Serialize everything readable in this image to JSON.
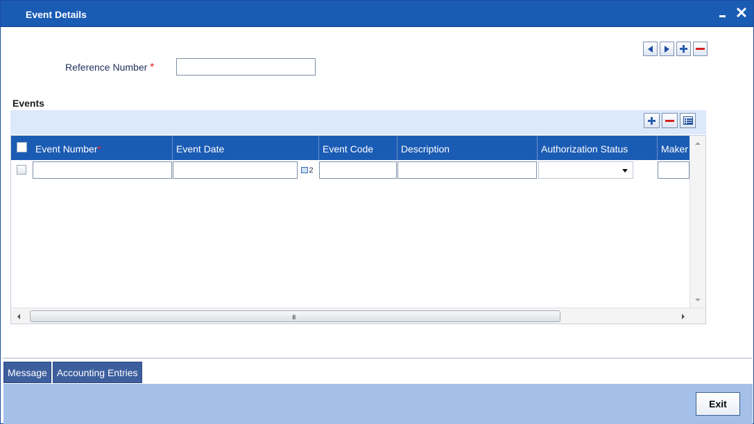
{
  "window": {
    "title": "Event Details",
    "controls": {
      "minimize": "minimize-icon",
      "close": "✕"
    }
  },
  "nav": [
    "prev-record-icon",
    "next-record-icon",
    "add-record-icon",
    "delete-record-icon"
  ],
  "reference": {
    "label": "Reference Number",
    "required_mark": "*",
    "value": ""
  },
  "events": {
    "title": "Events",
    "toolbar": [
      "add-row-icon",
      "delete-row-icon",
      "single-view-icon"
    ],
    "columns": [
      {
        "label": "Event Number",
        "required": "*"
      },
      {
        "label": "Event Date",
        "required": ""
      },
      {
        "label": "Event Code",
        "required": ""
      },
      {
        "label": "Description",
        "required": ""
      },
      {
        "label": "Authorization Status",
        "required": ""
      },
      {
        "label": "Maker",
        "required": ""
      }
    ],
    "row": {
      "event_number": "",
      "event_date": "",
      "date_button_label": "2",
      "event_code": "",
      "description": "",
      "authorization_status": ""
    },
    "scroll_grip": "III"
  },
  "tabs": [
    "Message",
    "Accounting Entries"
  ],
  "footer": {
    "exit_label": "Exit"
  }
}
